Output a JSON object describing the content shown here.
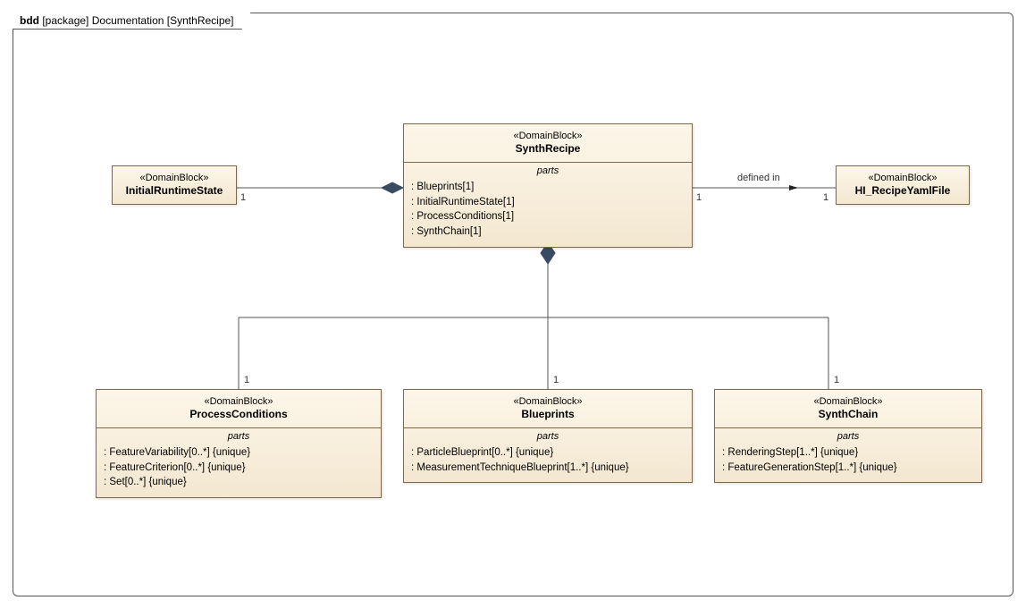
{
  "frame": {
    "kind": "bdd",
    "pkg": "[package]",
    "scope": "Documentation",
    "name": "[SynthRecipe]"
  },
  "blocks": {
    "initialRuntime": {
      "stereo": "«DomainBlock»",
      "name": "InitialRuntimeState"
    },
    "synthRecipe": {
      "stereo": "«DomainBlock»",
      "name": "SynthRecipe",
      "partsLabel": "parts",
      "parts": [
        " : Blueprints[1]",
        " : InitialRuntimeState[1]",
        " : ProcessConditions[1]",
        " : SynthChain[1]"
      ]
    },
    "recipeYaml": {
      "stereo": "«DomainBlock»",
      "name": "HI_RecipeYamlFile"
    },
    "processConditions": {
      "stereo": "«DomainBlock»",
      "name": "ProcessConditions",
      "partsLabel": "parts",
      "parts": [
        " : FeatureVariability[0..*] {unique}",
        " : FeatureCriterion[0..*] {unique}",
        " : Set[0..*] {unique}"
      ]
    },
    "blueprints": {
      "stereo": "«DomainBlock»",
      "name": "Blueprints",
      "partsLabel": "parts",
      "parts": [
        " : ParticleBlueprint[0..*] {unique}",
        " : MeasurementTechniqueBlueprint[1..*] {unique}"
      ]
    },
    "synthChain": {
      "stereo": "«DomainBlock»",
      "name": "SynthChain",
      "partsLabel": "parts",
      "parts": [
        " : RenderingStep[1..*] {unique}",
        " : FeatureGenerationStep[1..*] {unique}"
      ]
    }
  },
  "associations": {
    "definedIn": "defined in"
  },
  "multiplicities": {
    "irs_left": "1",
    "sr_left": "",
    "sr_right": "1",
    "yaml_right": "1",
    "pc_top": "1",
    "bp_top": "1",
    "sc_top": "1"
  }
}
